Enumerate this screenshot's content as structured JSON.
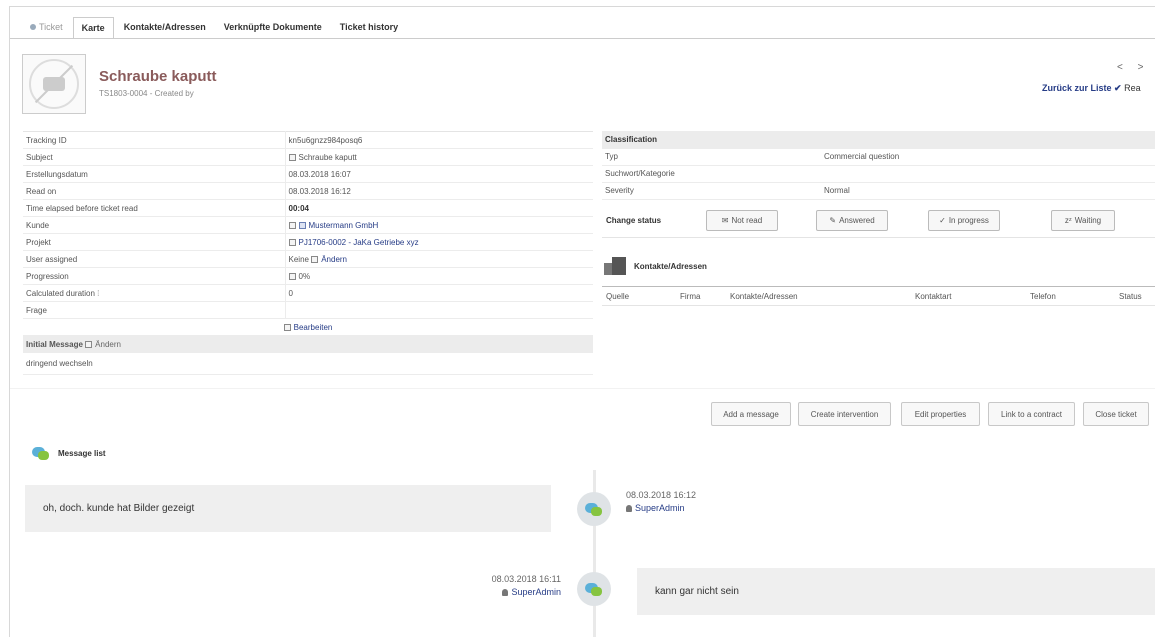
{
  "tabs": [
    {
      "label": "Ticket"
    },
    {
      "label": "Karte"
    },
    {
      "label": "Kontakte/Adressen"
    },
    {
      "label": "Verknüpfte Dokumente"
    },
    {
      "label": "Ticket history"
    }
  ],
  "header": {
    "title": "Schraube kaputt",
    "ref": "TS1803-0004 - Created by",
    "pager": "< >",
    "back_label": "Zurück zur Liste",
    "back_suffix": "Rea"
  },
  "details": [
    {
      "label": "Tracking ID",
      "value": "kn5u6gnzz984posq6"
    },
    {
      "label": "Subject",
      "value": "Schraube kaputt"
    },
    {
      "label": "Erstellungsdatum",
      "value": "08.03.2018 16:07"
    },
    {
      "label": "Read on",
      "value": "08.03.2018 16:12"
    },
    {
      "label": "Time elapsed before ticket read",
      "value": "00:04"
    },
    {
      "label": "Kunde",
      "value": "Mustermann GmbH"
    },
    {
      "label": "Projekt",
      "value": "PJ1706-0002 - JaKa Getriebe xyz"
    },
    {
      "label": "User assigned",
      "value_prefix": "Keine",
      "value": "Ändern"
    },
    {
      "label": "Progression",
      "value": "0%"
    },
    {
      "label": "Calculated duration",
      "value": "0"
    },
    {
      "label": "Frage",
      "value": ""
    }
  ],
  "edit_label": "Bearbeiten",
  "initial_message": {
    "heading": "Initial Message",
    "change_label": "Ändern",
    "text": "dringend wechseln"
  },
  "classification": {
    "heading": "Classification",
    "rows": [
      {
        "label": "Typ",
        "value": "Commercial question"
      },
      {
        "label": "Suchwort/Kategorie",
        "value": ""
      },
      {
        "label": "Severity",
        "value": "Normal"
      }
    ]
  },
  "change_status": {
    "label": "Change status",
    "buttons": [
      "Not read",
      "Answered",
      "In progress",
      "Waiting"
    ]
  },
  "contacts": {
    "heading": "Kontakte/Adressen",
    "columns": [
      "Quelle",
      "Firma",
      "Kontakte/Adressen",
      "Kontaktart",
      "Telefon",
      "Status"
    ]
  },
  "actions": [
    "Add a message",
    "Create intervention",
    "Edit properties",
    "Link to a contract",
    "Close ticket"
  ],
  "message_list": {
    "heading": "Message list",
    "messages": [
      {
        "text": "oh, doch. kunde hat Bilder gezeigt",
        "date": "08.03.2018 16:12",
        "user": "SuperAdmin"
      },
      {
        "text": "kann gar nicht sein",
        "date": "08.03.2018 16:11",
        "user": "SuperAdmin"
      }
    ]
  },
  "colors": {
    "link": "#263c86",
    "title": "#8a5b5b",
    "header_bg": "#ececec"
  }
}
